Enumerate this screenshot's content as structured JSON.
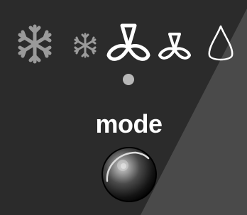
{
  "mode_selector": {
    "label": "mode",
    "options": [
      {
        "name": "cool-high",
        "icon": "snowflake-large-icon",
        "active": false
      },
      {
        "name": "cool-low",
        "icon": "snowflake-small-icon",
        "active": false
      },
      {
        "name": "fan-high",
        "icon": "fan-large-icon",
        "active": true
      },
      {
        "name": "fan-low",
        "icon": "fan-small-icon",
        "active": true
      },
      {
        "name": "dry",
        "icon": "water-drop-icon",
        "active": true
      }
    ]
  },
  "colors": {
    "panel": "#2b2b2b",
    "label": "#ffffff",
    "icon_active": "#ffffff",
    "icon_inactive": "#9a9a9a",
    "indicator": "#b8b8b8"
  }
}
